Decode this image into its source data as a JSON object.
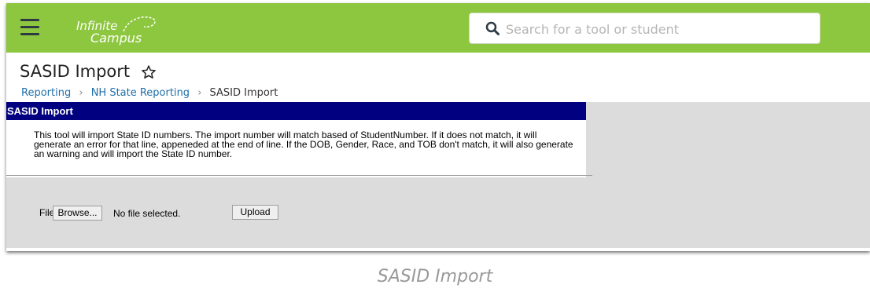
{
  "header": {
    "logo": {
      "line1": "Infinite",
      "line2": "Campus"
    },
    "search": {
      "placeholder": "Search for a tool or student"
    },
    "brand_color": "#8dc63f"
  },
  "page": {
    "title": "SASID Import",
    "breadcrumb": [
      {
        "label": "Reporting"
      },
      {
        "label": "NH State Reporting"
      },
      {
        "label": "SASID Import"
      }
    ]
  },
  "panel": {
    "header": "SASID Import",
    "header_color": "#000080",
    "description": "This tool will import State ID numbers. The import number will match based of StudentNumber. If it does not match, it will generate an error for that line, appeneded at the end of line. If the DOB, Gender, Race, and TOB don't match, it will also generate an warning and will import the State ID number."
  },
  "upload_form": {
    "file_label": "File",
    "browse_label": "Browse...",
    "file_status": "No file selected.",
    "upload_label": "Upload"
  },
  "caption": "SASID Import"
}
